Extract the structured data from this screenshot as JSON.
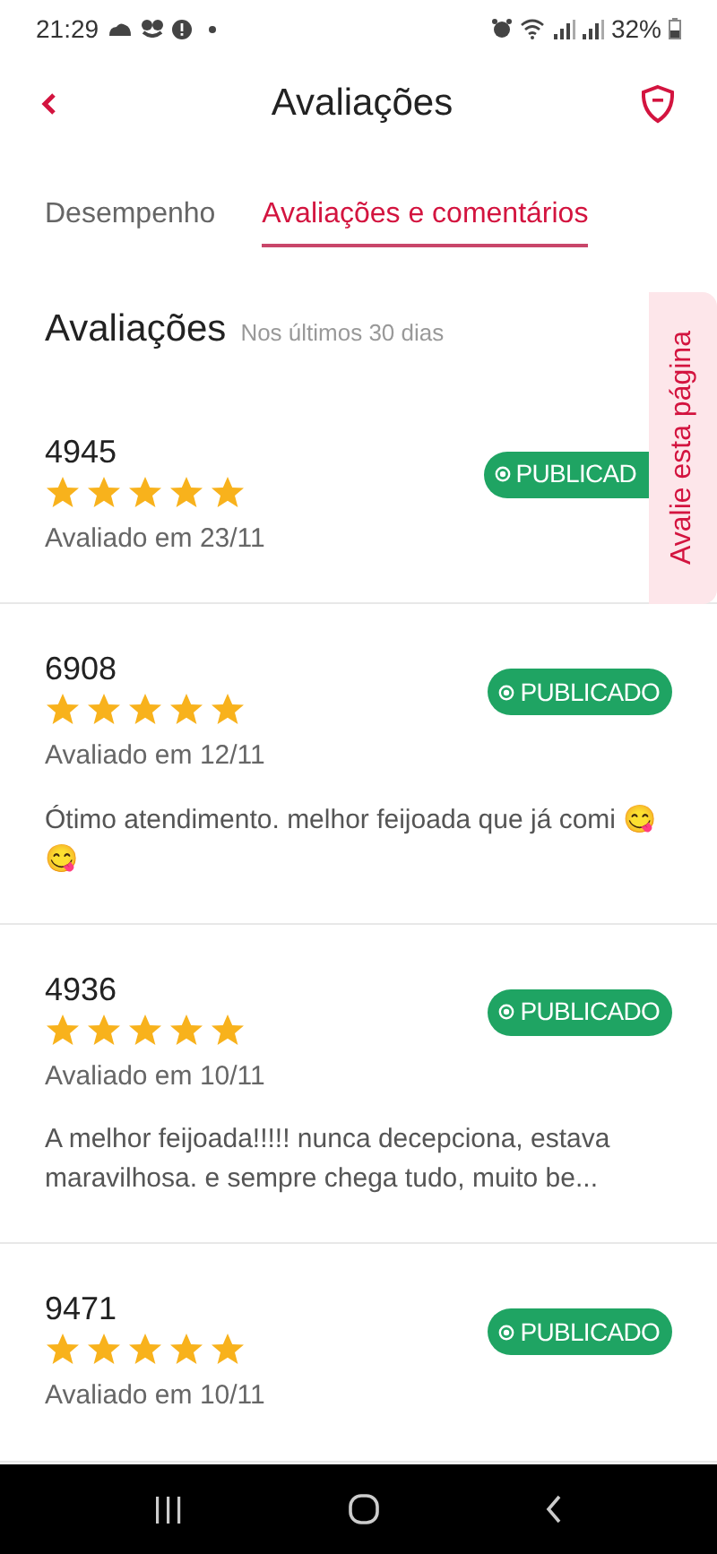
{
  "status_bar": {
    "time": "21:29",
    "battery": "32%"
  },
  "header": {
    "title": "Avaliações"
  },
  "tabs": [
    {
      "label": "Desempenho",
      "selected": false
    },
    {
      "label": "Avaliações e comentários",
      "selected": true
    }
  ],
  "section": {
    "title": "Avaliações",
    "subtitle": "Nos últimos 30 dias"
  },
  "side_tab": {
    "label": "Avalie esta página"
  },
  "reviews": [
    {
      "order": "4945",
      "stars": 5,
      "date": "Avaliado em 23/11",
      "status": "PUBLICAD"
    },
    {
      "order": "6908",
      "stars": 5,
      "date": "Avaliado em 12/11",
      "status": "PUBLICADO",
      "comment": "Ótimo atendimento. melhor feijoada que já comi 😋😋"
    },
    {
      "order": "4936",
      "stars": 5,
      "date": "Avaliado em 10/11",
      "status": "PUBLICADO",
      "comment": "A melhor feijoada!!!!!  nunca decepciona, estava maravilhosa. e sempre chega tudo, muito be..."
    },
    {
      "order": "9471",
      "stars": 5,
      "date": "Avaliado em 10/11",
      "status": "PUBLICADO"
    }
  ]
}
